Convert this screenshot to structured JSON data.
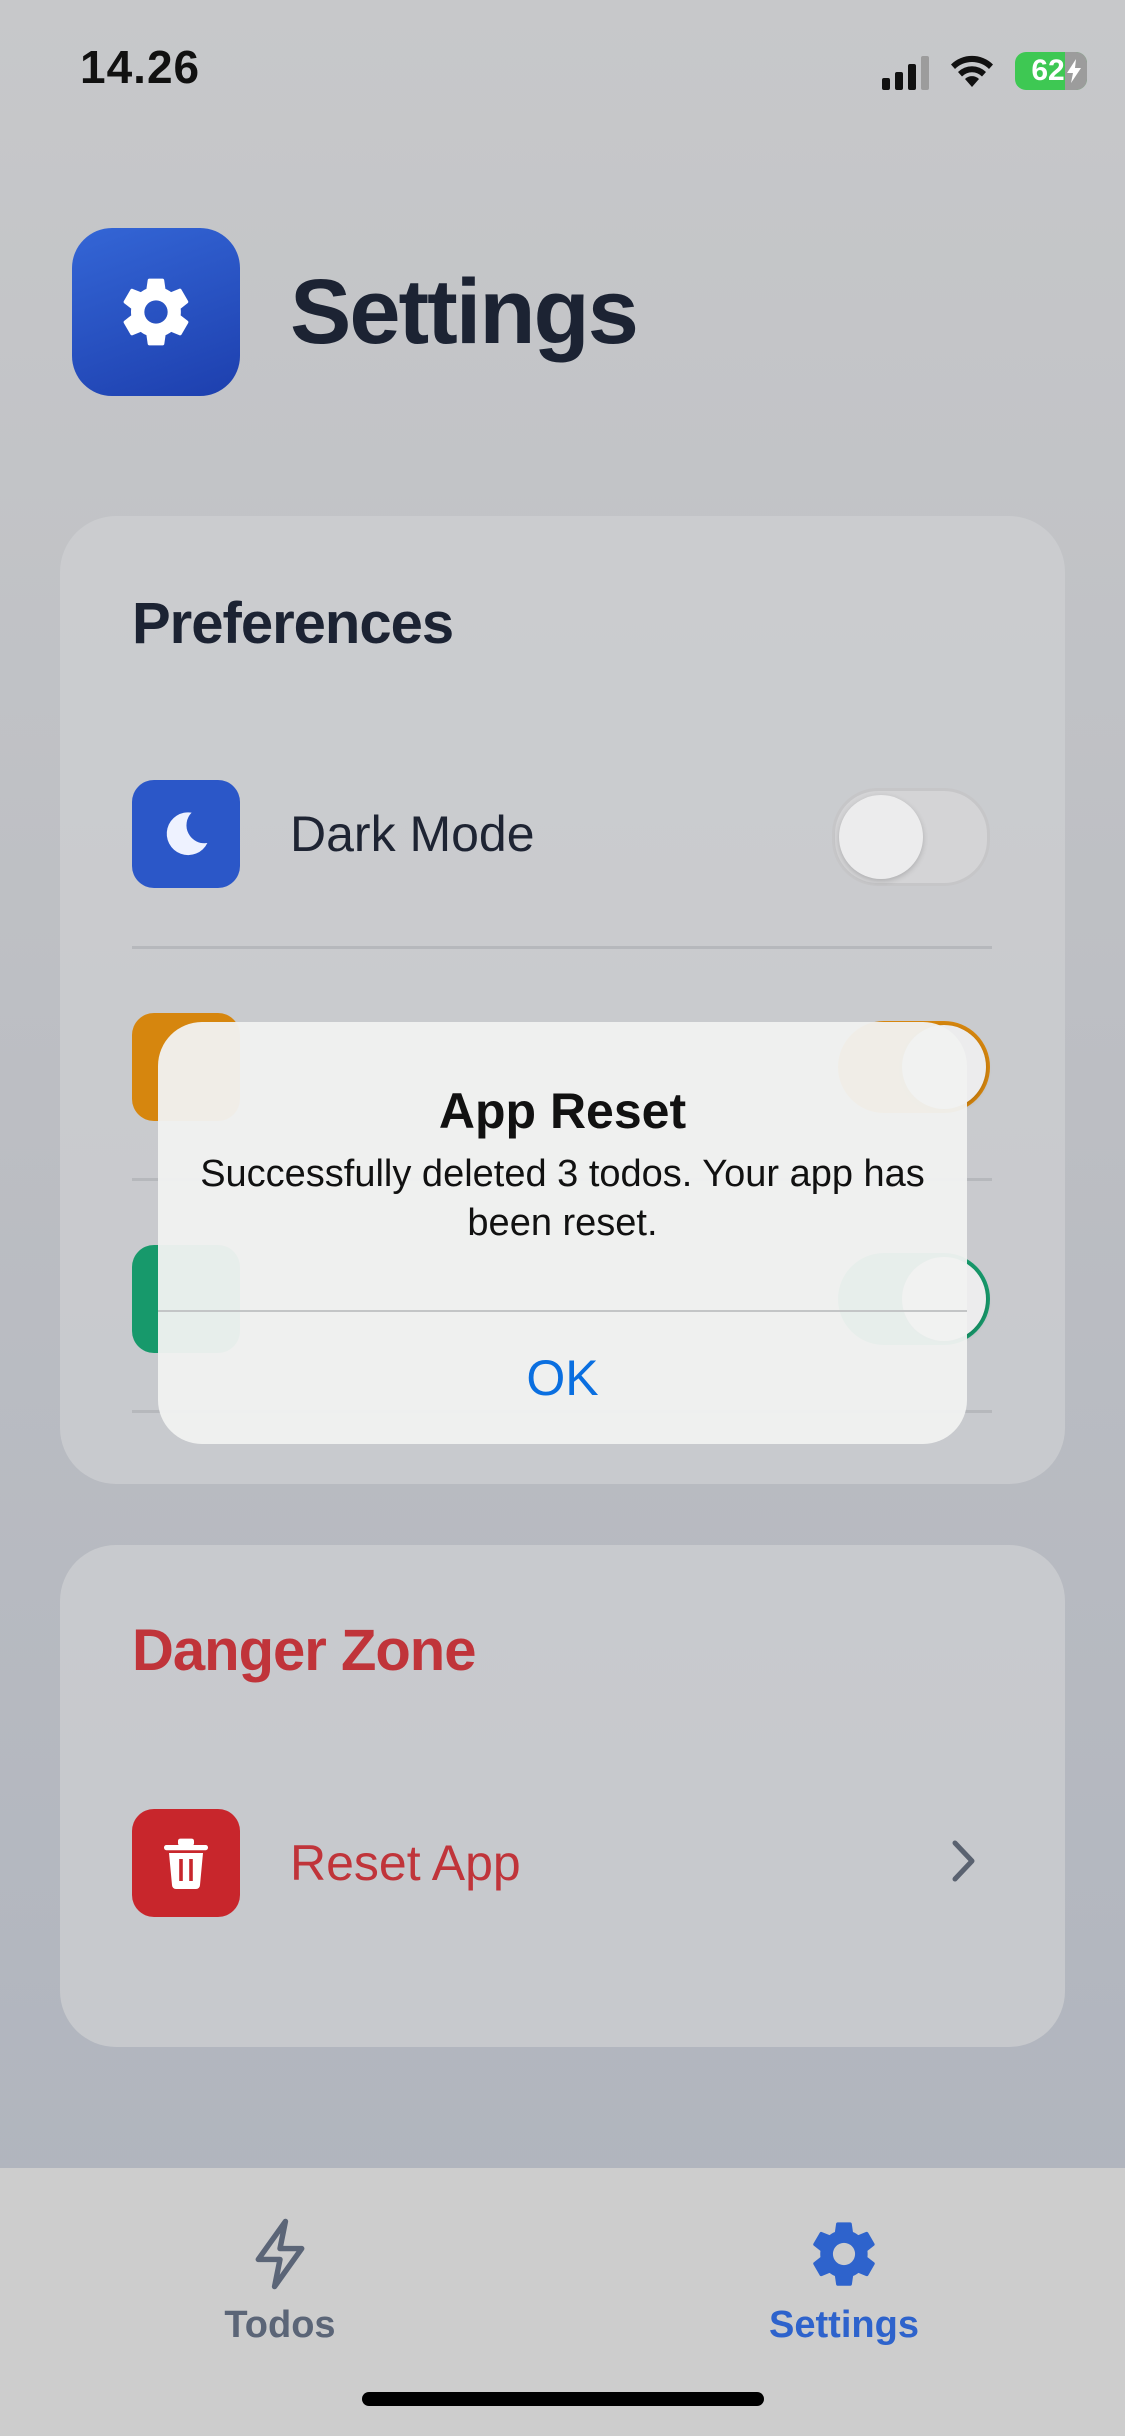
{
  "status_bar": {
    "time": "14.26",
    "battery": "62"
  },
  "header": {
    "title": "Settings",
    "icon": "gear-icon"
  },
  "preferences": {
    "title": "Preferences",
    "rows": [
      {
        "label": "Dark Mode",
        "icon": "moon-icon",
        "color": "#2b57c8",
        "toggle": "off"
      },
      {
        "label": "",
        "icon": "unknown-icon",
        "color": "#d6860e",
        "toggle": "on"
      },
      {
        "label": "",
        "icon": "unknown-icon",
        "color": "#17996b",
        "toggle": "on"
      }
    ]
  },
  "danger_zone": {
    "title": "Danger Zone",
    "title_color": "#c0343a",
    "reset_label": "Reset App",
    "icon": "trash-icon"
  },
  "alert": {
    "title": "App Reset",
    "message": "Successfully deleted 3 todos. Your app has been reset.",
    "button": "OK"
  },
  "tab_bar": {
    "tabs": [
      {
        "label": "Todos",
        "icon": "bolt-icon",
        "active": false
      },
      {
        "label": "Settings",
        "icon": "gear-icon",
        "active": true
      }
    ],
    "active_color": "#2e63cc"
  }
}
